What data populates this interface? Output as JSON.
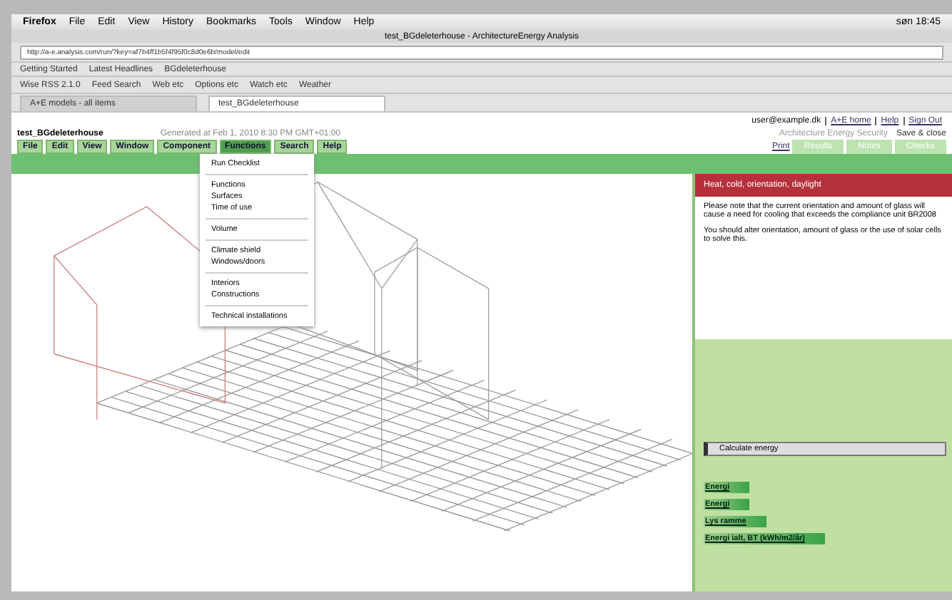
{
  "menubar": {
    "app": "Firefox",
    "items": [
      "File",
      "Edit",
      "View",
      "History",
      "Bookmarks",
      "Tools",
      "Window",
      "Help"
    ],
    "clock": "søn 18:45"
  },
  "window": {
    "title": "test_BGdeleterhouse - ArchitectureEnergy Analysis"
  },
  "navbar": {
    "url": "http://a-e.analysis.com/run/?key=af7b4ff1b5f4f95f0c8d0e6b/model/edit"
  },
  "bookmarks": [
    "Getting Started",
    "Latest Headlines",
    "BGdeleterhouse"
  ],
  "addon_bar": {
    "items": [
      "Wise RSS 2.1.0",
      "Feed Search",
      "Web etc",
      "Options etc",
      "Watch etc",
      "Weather"
    ]
  },
  "tabs": [
    {
      "label": "A+E models - all items",
      "selected": false
    },
    {
      "label": "test_BGdeleterhouse",
      "selected": true
    }
  ],
  "page": {
    "user_links": [
      "user@example.dk",
      "A+E home",
      "Help",
      "Sign Out"
    ],
    "title": "test_BGdeleterhouse",
    "generated": "Generated at Feb 1, 2010 8:30 PM GMT+01:00",
    "actions": [
      "Architecture Energy Security",
      "Save & close"
    ],
    "menu": [
      {
        "label": "File",
        "selected": false
      },
      {
        "label": "Edit",
        "selected": false
      },
      {
        "label": "View",
        "selected": false
      },
      {
        "label": "Window",
        "selected": false
      },
      {
        "label": "Component",
        "selected": false
      },
      {
        "label": "Functions",
        "selected": true
      },
      {
        "label": "Search",
        "selected": false
      },
      {
        "label": "Help",
        "selected": false
      }
    ],
    "print": "Print",
    "right_tabs": [
      "Results",
      "Notes",
      "Checks"
    ],
    "dropdown": [
      [
        "Run Checklist"
      ],
      [
        "Functions",
        "Surfaces",
        "Time of use"
      ],
      [
        "Volume"
      ],
      [
        "Climate shield",
        "Windows/doors"
      ],
      [
        "Interiors",
        "Constructions"
      ],
      [
        "Technical installations"
      ]
    ],
    "panel": {
      "header": "Heat, cold, orientation, daylight",
      "paragraphs": [
        "Please note that the current orientation and amount of glass will cause a need for cooling that exceeds the compliance unit BR2008",
        "You should alter orientation, amount of glass or the use of solar cells to solve this."
      ],
      "button": "Calculate energy",
      "results": [
        {
          "label": "Energi"
        },
        {
          "label": "Energi"
        },
        {
          "label": "Lys ramme"
        },
        {
          "label": "Energi ialt, BT (kWh/m2/år)"
        }
      ]
    }
  }
}
